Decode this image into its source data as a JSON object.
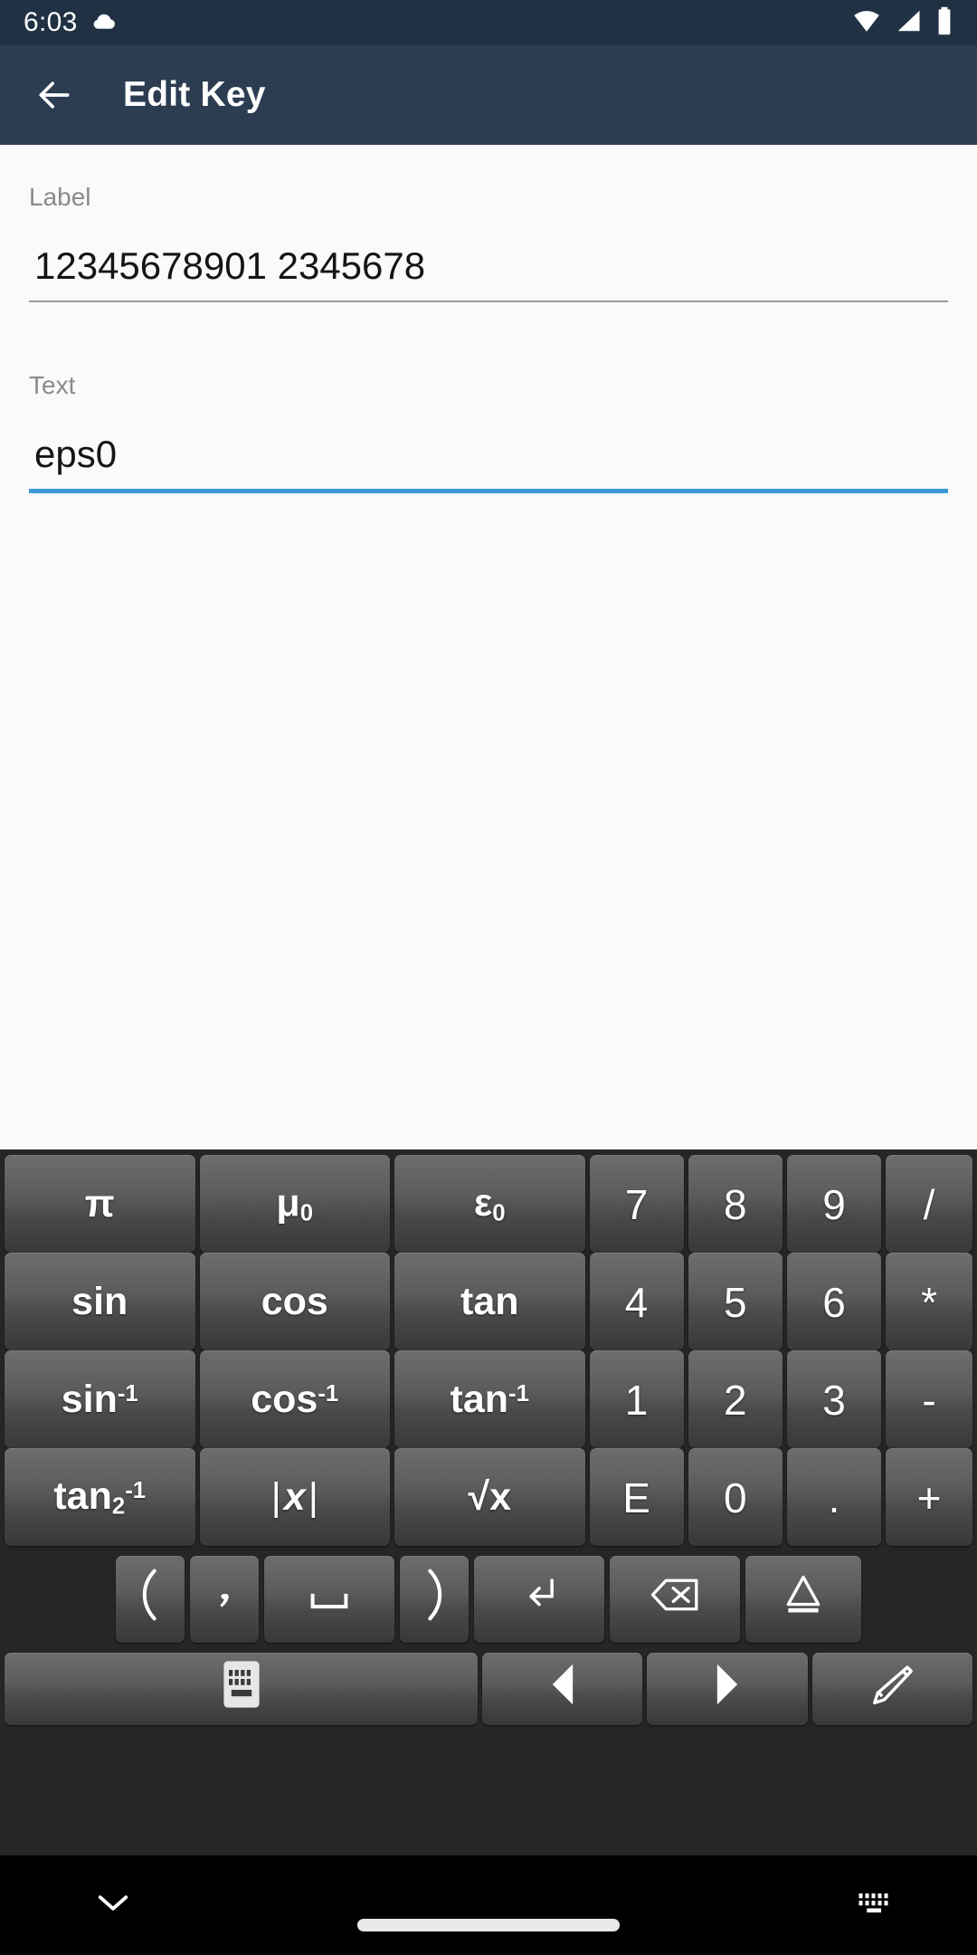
{
  "statusbar": {
    "clock": "6:03",
    "icons": [
      "cloud-icon",
      "wifi-icon",
      "cell-signal-icon",
      "battery-icon"
    ]
  },
  "appbar": {
    "back_icon": "arrow-back-icon",
    "title": "Edit Key"
  },
  "form": {
    "label_field": {
      "label": "Label",
      "value": "12345678901 2345678",
      "focused": false
    },
    "text_field": {
      "label": "Text",
      "value": "eps0",
      "focused": true
    }
  },
  "colors": {
    "status_bar": "#203144",
    "app_bar": "#2c3d52",
    "content_bg": "#fafafa",
    "accent_focus": "#3b9ad6",
    "underline_idle": "#9b9b9b",
    "keyboard_bg": "#262626",
    "key_top": "#6d6d6d",
    "key_bottom": "#383838",
    "key_text": "#fefefe",
    "nav_bg": "#000000"
  },
  "keyboard": {
    "rows": [
      {
        "name": "row-1",
        "keys": [
          {
            "name": "key-pi",
            "label": "π",
            "kind": "wide"
          },
          {
            "name": "key-mu0",
            "label": "μ",
            "sub": "0",
            "kind": "wide"
          },
          {
            "name": "key-epsilon0",
            "label": "ε",
            "sub": "0",
            "kind": "wide"
          },
          {
            "name": "key-7",
            "label": "7",
            "kind": "num"
          },
          {
            "name": "key-8",
            "label": "8",
            "kind": "num"
          },
          {
            "name": "key-9",
            "label": "9",
            "kind": "num"
          },
          {
            "name": "key-divide",
            "label": "/",
            "kind": "op"
          }
        ]
      },
      {
        "name": "row-2",
        "keys": [
          {
            "name": "key-sin",
            "label": "sin",
            "kind": "wide"
          },
          {
            "name": "key-cos",
            "label": "cos",
            "kind": "wide"
          },
          {
            "name": "key-tan",
            "label": "tan",
            "kind": "wide"
          },
          {
            "name": "key-4",
            "label": "4",
            "kind": "num"
          },
          {
            "name": "key-5",
            "label": "5",
            "kind": "num"
          },
          {
            "name": "key-6",
            "label": "6",
            "kind": "num"
          },
          {
            "name": "key-multiply",
            "label": "*",
            "kind": "op"
          }
        ]
      },
      {
        "name": "row-3",
        "keys": [
          {
            "name": "key-asin",
            "label": "sin",
            "sup": "-1",
            "kind": "wide"
          },
          {
            "name": "key-acos",
            "label": "cos",
            "sup": "-1",
            "kind": "wide"
          },
          {
            "name": "key-atan",
            "label": "tan",
            "sup": "-1",
            "kind": "wide"
          },
          {
            "name": "key-1",
            "label": "1",
            "kind": "num"
          },
          {
            "name": "key-2",
            "label": "2",
            "kind": "num"
          },
          {
            "name": "key-3",
            "label": "3",
            "kind": "num"
          },
          {
            "name": "key-minus",
            "label": "-",
            "kind": "op"
          }
        ]
      },
      {
        "name": "row-4",
        "keys": [
          {
            "name": "key-atan2",
            "label": "tan",
            "sub": "2",
            "sup": "-1",
            "kind": "wide"
          },
          {
            "name": "key-abs",
            "label": "| x |",
            "kind": "wide",
            "italic_middle": true
          },
          {
            "name": "key-sqrt",
            "label": "√x",
            "kind": "wide"
          },
          {
            "name": "key-E",
            "label": "E",
            "kind": "num"
          },
          {
            "name": "key-0",
            "label": "0",
            "kind": "num"
          },
          {
            "name": "key-decimal",
            "label": ".",
            "kind": "num"
          },
          {
            "name": "key-plus",
            "label": "+",
            "kind": "op"
          }
        ]
      }
    ],
    "mid_row": {
      "name": "row-5",
      "keys": [
        {
          "name": "key-paren-open",
          "label": "(",
          "icon": "paren-open-icon"
        },
        {
          "name": "key-comma",
          "label": ",",
          "icon": "comma-icon"
        },
        {
          "name": "key-space",
          "label": "␣",
          "icon": "space-icon"
        },
        {
          "name": "key-paren-close",
          "label": ")",
          "icon": "paren-close-icon"
        },
        {
          "name": "key-enter",
          "label": "↵",
          "icon": "enter-icon"
        },
        {
          "name": "key-backspace",
          "label": "⌫",
          "icon": "backspace-icon"
        },
        {
          "name": "key-shift",
          "label": "△",
          "icon": "shift-icon"
        }
      ]
    },
    "bottom_row": {
      "name": "row-6",
      "keys": [
        {
          "name": "key-switch-keyboard",
          "icon": "keyboard-icon"
        },
        {
          "name": "key-cursor-left",
          "icon": "arrow-left-icon",
          "label": "◀"
        },
        {
          "name": "key-cursor-right",
          "icon": "arrow-right-icon",
          "label": "▶"
        },
        {
          "name": "key-edit",
          "icon": "pencil-icon"
        }
      ]
    }
  },
  "navbar": {
    "hide_keyboard_icon": "chevron-down-icon",
    "home_pill": "home-gesture-pill",
    "keyboard_switch_icon": "keyboard-icon"
  }
}
